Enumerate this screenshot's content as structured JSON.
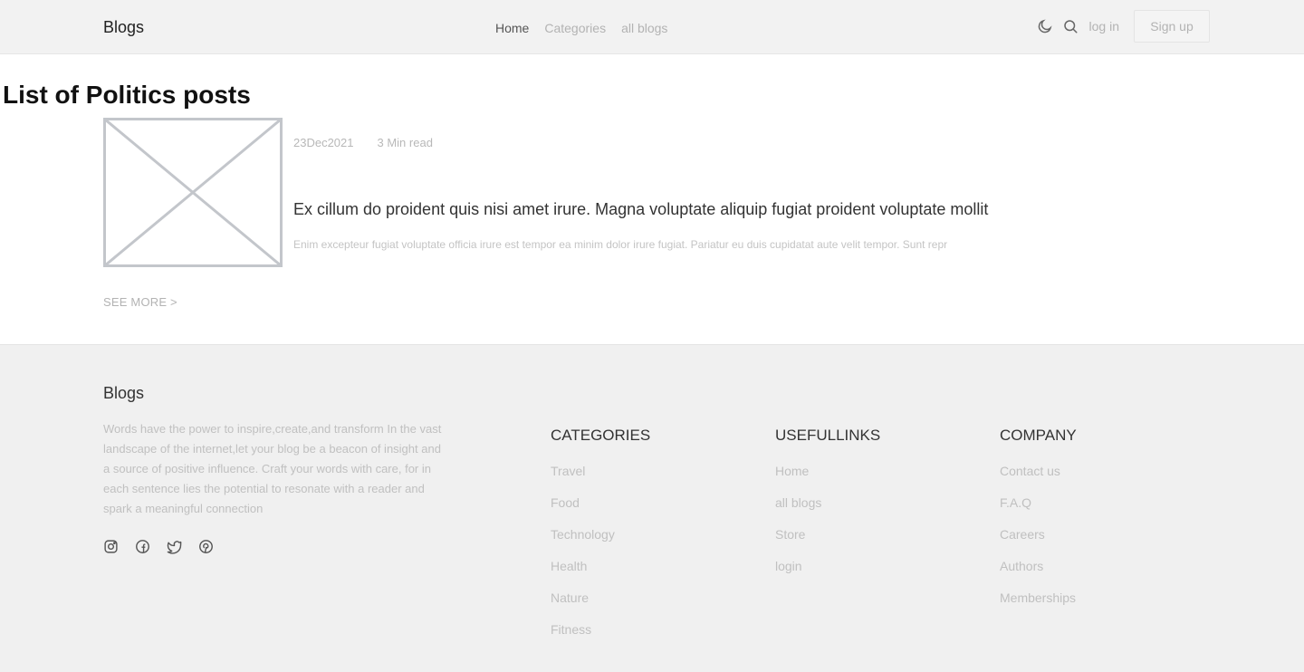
{
  "header": {
    "brand": "Blogs",
    "nav": [
      "Home",
      "Categories",
      "all blogs"
    ],
    "login": "log in",
    "signup": "Sign up",
    "icons": [
      "moon-icon",
      "search-icon"
    ]
  },
  "main": {
    "title": "List of Politics posts",
    "post": {
      "date": "23Dec2021",
      "read_time": "3 Min read",
      "title": "Ex cillum do proident quis nisi amet irure. Magna voluptate aliquip fugiat proident voluptate mollit",
      "excerpt": "Enim excepteur fugiat voluptate officia irure est tempor ea minim dolor irure fugiat. Pariatur eu duis cupidatat aute velit tempor. Sunt repr"
    },
    "see_more": "SEE MORE  >"
  },
  "footer": {
    "brand": "Blogs",
    "description": "Words have the power to inspire,create,and transform In the vast landscape of the internet,let your blog be a beacon of insight and a source of positive influence. Craft your words with care, for in each sentence lies the potential to resonate with a reader and spark a meaningful connection",
    "socials": [
      "instagram-icon",
      "facebook-icon",
      "twitter-icon",
      "pinterest-icon"
    ],
    "categories": {
      "heading": "CATEGORIES",
      "links": [
        "Travel",
        "Food",
        "Technology",
        "Health",
        "Nature",
        "Fitness"
      ]
    },
    "useful": {
      "heading": "USEFULLINKS",
      "links": [
        "Home",
        "all blogs",
        "Store",
        "login"
      ]
    },
    "company": {
      "heading": "COMPANY",
      "links": [
        "Contact us",
        "F.A.Q",
        "Careers",
        "Authors",
        "Memberships"
      ]
    }
  },
  "colors": {
    "header_bg": "#f2f2f2",
    "footer_bg": "#f0f0f0",
    "muted_text": "#b3b3b3"
  }
}
